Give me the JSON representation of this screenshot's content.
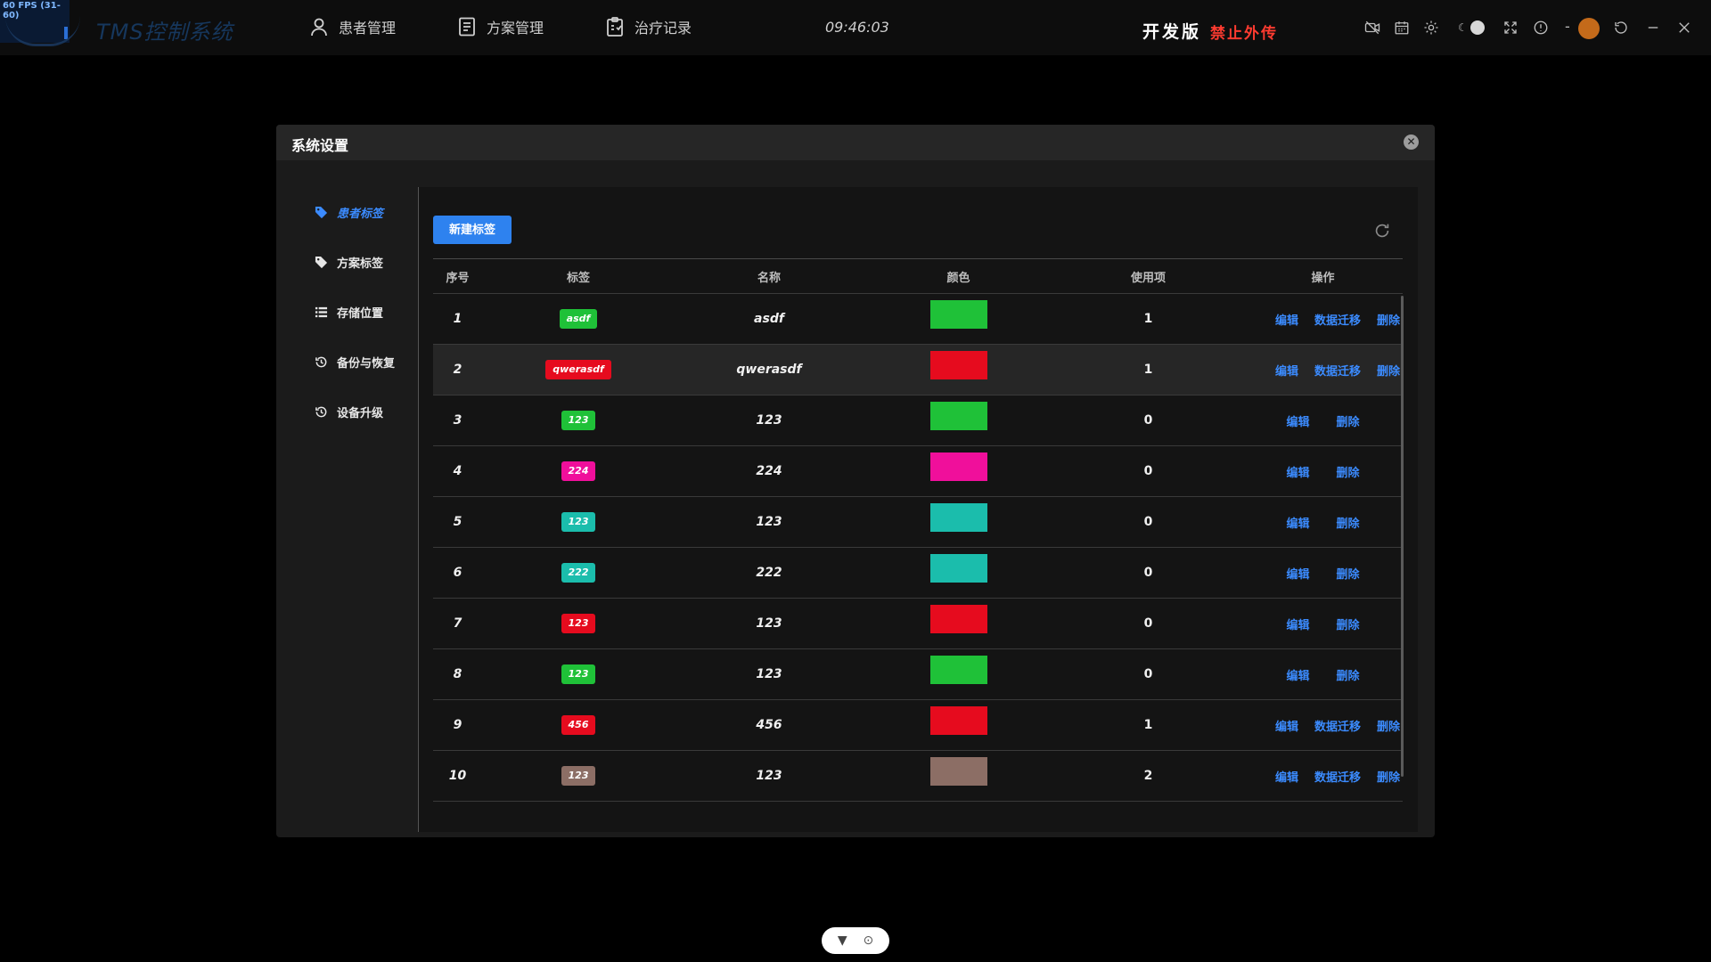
{
  "topbar": {
    "fps": "60 FPS (31-60)",
    "app_title": "TMS控制系统",
    "nav": [
      {
        "label": "患者管理",
        "icon": "user-icon"
      },
      {
        "label": "方案管理",
        "icon": "document-icon"
      },
      {
        "label": "治疗记录",
        "icon": "clipboard-icon"
      }
    ],
    "clock": "09:46:03",
    "edition": "开发版",
    "warning": "禁止外传"
  },
  "dialog": {
    "title": "系统设置",
    "menu": [
      {
        "label": "患者标签",
        "icon": "tag-icon",
        "active": true
      },
      {
        "label": "方案标签",
        "icon": "tag-icon",
        "active": false
      },
      {
        "label": "存储位置",
        "icon": "list-icon",
        "active": false
      },
      {
        "label": "备份与恢复",
        "icon": "history-icon",
        "active": false
      },
      {
        "label": "设备升级",
        "icon": "history-icon",
        "active": false
      }
    ],
    "new_button": "新建标签",
    "table": {
      "headers": [
        "序号",
        "标签",
        "名称",
        "颜色",
        "使用项",
        "操作"
      ],
      "ops": {
        "edit": "编辑",
        "migrate": "数据迁移",
        "delete": "删除"
      },
      "rows": [
        {
          "idx": "1",
          "tag": "asdf",
          "name": "asdf",
          "color": "#1fc138",
          "uses": "1",
          "migrate": true
        },
        {
          "idx": "2",
          "tag": "qwerasdf",
          "name": "qwerasdf",
          "color": "#e60b1e",
          "uses": "1",
          "migrate": true
        },
        {
          "idx": "3",
          "tag": "123",
          "name": "123",
          "color": "#1fc138",
          "uses": "0",
          "migrate": false
        },
        {
          "idx": "4",
          "tag": "224",
          "name": "224",
          "color": "#f00f9b",
          "uses": "0",
          "migrate": false
        },
        {
          "idx": "5",
          "tag": "123",
          "name": "123",
          "color": "#1bbdac",
          "uses": "0",
          "migrate": false
        },
        {
          "idx": "6",
          "tag": "222",
          "name": "222",
          "color": "#1bbdac",
          "uses": "0",
          "migrate": false
        },
        {
          "idx": "7",
          "tag": "123",
          "name": "123",
          "color": "#e60b1e",
          "uses": "0",
          "migrate": false
        },
        {
          "idx": "8",
          "tag": "123",
          "name": "123",
          "color": "#1fc138",
          "uses": "0",
          "migrate": false
        },
        {
          "idx": "9",
          "tag": "456",
          "name": "456",
          "color": "#e60b1e",
          "uses": "1",
          "migrate": true
        },
        {
          "idx": "10",
          "tag": "123",
          "name": "123",
          "color": "#8c6e65",
          "uses": "2",
          "migrate": true
        }
      ]
    }
  },
  "colors": {
    "accent": "#2e82ef",
    "warning": "#ff3b30"
  }
}
